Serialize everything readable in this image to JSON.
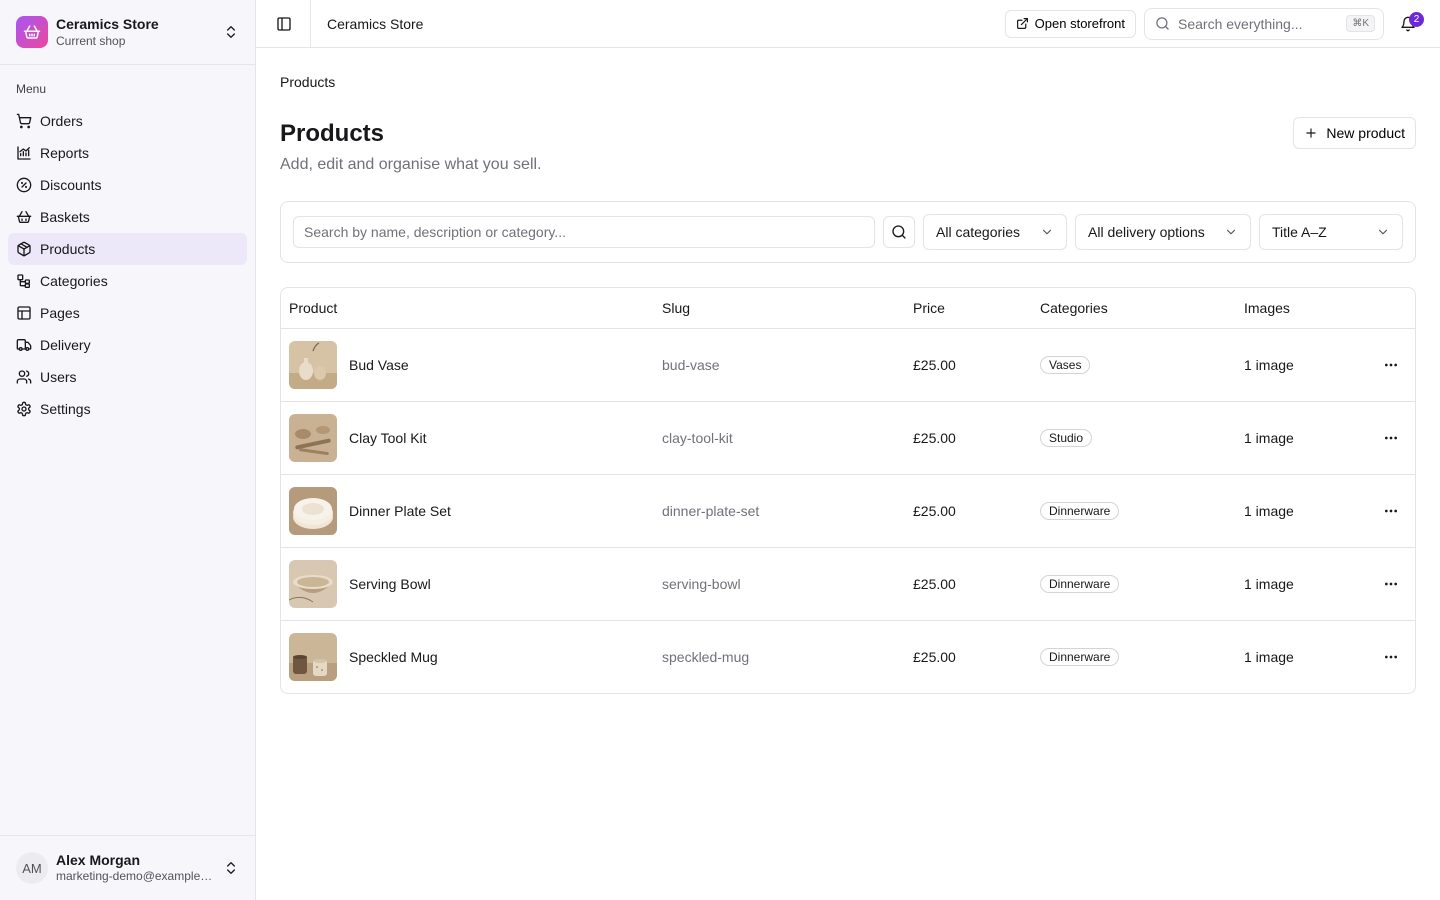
{
  "shop": {
    "name": "Ceramics Store",
    "subtitle": "Current shop"
  },
  "menu": {
    "label": "Menu",
    "items": [
      {
        "label": "Orders",
        "icon": "cart-icon"
      },
      {
        "label": "Reports",
        "icon": "chart-icon"
      },
      {
        "label": "Discounts",
        "icon": "discount-icon"
      },
      {
        "label": "Baskets",
        "icon": "basket-icon"
      },
      {
        "label": "Products",
        "icon": "box-icon",
        "active": true
      },
      {
        "label": "Categories",
        "icon": "categories-icon"
      },
      {
        "label": "Pages",
        "icon": "pages-icon"
      },
      {
        "label": "Delivery",
        "icon": "truck-icon"
      },
      {
        "label": "Users",
        "icon": "users-icon"
      },
      {
        "label": "Settings",
        "icon": "gear-icon"
      }
    ]
  },
  "user": {
    "initials": "AM",
    "name": "Alex Morgan",
    "email": "marketing-demo@example.com"
  },
  "topbar": {
    "title": "Ceramics Store",
    "storefront_label": "Open storefront",
    "search_placeholder": "Search everything...",
    "shortcut": "⌘K",
    "notification_count": "2"
  },
  "page": {
    "breadcrumb": "Products",
    "title": "Products",
    "subtitle": "Add, edit and organise what you sell.",
    "new_button": "New product"
  },
  "filters": {
    "search_placeholder": "Search by name, description or category...",
    "category": "All categories",
    "delivery": "All delivery options",
    "sort": "Title A–Z"
  },
  "table": {
    "columns": [
      "Product",
      "Slug",
      "Price",
      "Categories",
      "Images"
    ],
    "rows": [
      {
        "name": "Bud Vase",
        "slug": "bud-vase",
        "price": "£25.00",
        "category": "Vases",
        "images": "1 image"
      },
      {
        "name": "Clay Tool Kit",
        "slug": "clay-tool-kit",
        "price": "£25.00",
        "category": "Studio",
        "images": "1 image"
      },
      {
        "name": "Dinner Plate Set",
        "slug": "dinner-plate-set",
        "price": "£25.00",
        "category": "Dinnerware",
        "images": "1 image"
      },
      {
        "name": "Serving Bowl",
        "slug": "serving-bowl",
        "price": "£25.00",
        "category": "Dinnerware",
        "images": "1 image"
      },
      {
        "name": "Speckled Mug",
        "slug": "speckled-mug",
        "price": "£25.00",
        "category": "Dinnerware",
        "images": "1 image"
      }
    ]
  },
  "colors": {
    "accent": "#6d28d9",
    "active_nav": "#ede8f9",
    "sidebar_bg": "#f7f6fb"
  }
}
